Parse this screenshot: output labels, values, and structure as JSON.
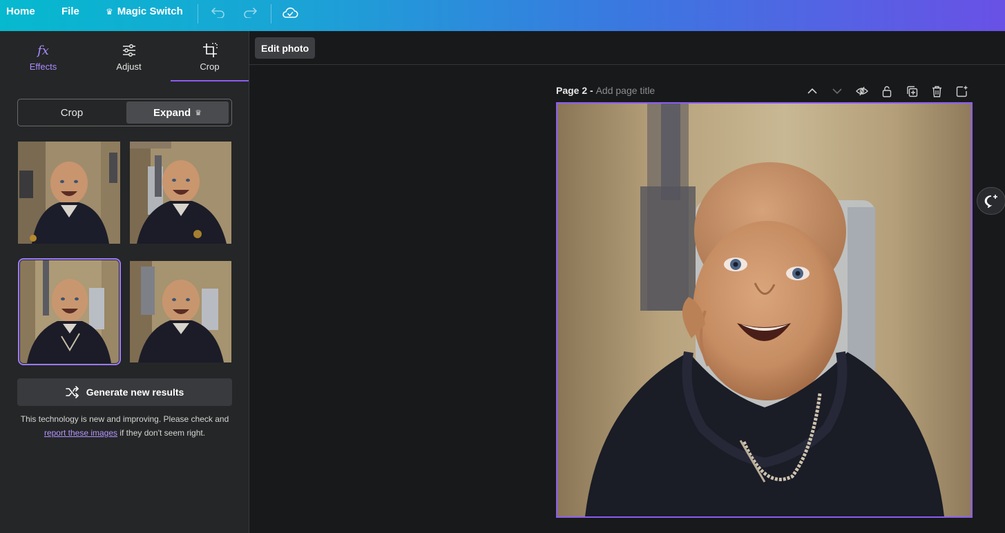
{
  "topbar": {
    "home_label": "Home",
    "file_label": "File",
    "magic_switch_label": "Magic Switch"
  },
  "left_panel": {
    "tabs": [
      {
        "label": "Effects",
        "icon": "fx-icon"
      },
      {
        "label": "Adjust",
        "icon": "sliders-icon"
      },
      {
        "label": "Crop",
        "icon": "crop-icon"
      }
    ],
    "active_tab": "Crop",
    "segmented": {
      "crop_label": "Crop",
      "expand_label": "Expand"
    },
    "selected_result_index": 2,
    "generate_label": "Generate new results",
    "note_before": "This technology is new and improving. Please check and ",
    "note_link": "report these images",
    "note_after": " if they don't seem right."
  },
  "canvas": {
    "edit_photo_label": "Edit photo",
    "page_label": "Page 2 - ",
    "page_title_placeholder": "Add page title"
  },
  "colors": {
    "accent": "#8b5cf6",
    "accent_text": "#a98cff",
    "panel_bg": "#252627",
    "canvas_bg": "#18191b"
  }
}
